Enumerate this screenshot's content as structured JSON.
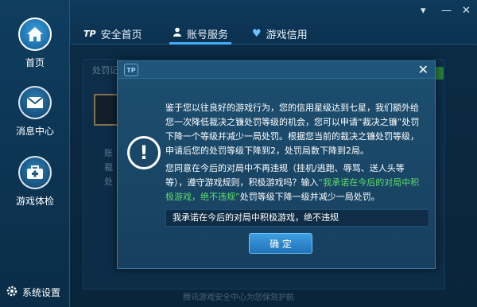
{
  "sidebar": {
    "items": [
      {
        "label": "首页",
        "icon": "home-icon"
      },
      {
        "label": "消息中心",
        "icon": "mail-icon"
      },
      {
        "label": "游戏体检",
        "icon": "medical-kit-icon"
      }
    ],
    "settings_label": "系统设置",
    "settings_icon": "gear-icon"
  },
  "tabs": [
    {
      "label": "安全首页",
      "icon": "tp-logo-icon"
    },
    {
      "label": "账号服务",
      "icon": "user-icon"
    },
    {
      "label": "游戏信用",
      "icon": "heart-icon"
    }
  ],
  "window": {
    "minimize": "—",
    "close": "✕",
    "dropdown": "▾"
  },
  "background": {
    "section_label": "处罚记",
    "fragment_1": "账",
    "fragment_2": "裁",
    "fragment_3": "处",
    "footer": "腾讯游戏安全中心为您保驾护航"
  },
  "dialog": {
    "logo": "TP",
    "close": "✕",
    "alert_symbol": "!",
    "paragraph1": "鉴于您以往良好的游戏行为，您的信用星级达到七星，我们额外给您一次降低裁决之镰处罚等级的机会，您可以申请“裁决之镰”处罚下降一个等级并减少一局处罚。根据您当前的裁决之镰处罚等级，申请后您的处罚等级下降到2，处罚局数下降到2局。",
    "paragraph2_a": "您同意在今后的对局中不再违规（挂机/逃跑、辱骂、送人头等等），遵守游戏规则，积极游戏吗？输入",
    "paragraph2_quote": "“我承诺在今后的对局中积极游戏，绝不违规”",
    "paragraph2_b": "处罚等级下降一级并减少一局处罚。",
    "pledge_value": "我承诺在今后的对局中积极游戏，绝不违规",
    "confirm_label": "确 定"
  },
  "colors": {
    "accent": "#3fb0ff",
    "highlight_green": "#5ddd6a",
    "confirm": "#2a86cc"
  }
}
